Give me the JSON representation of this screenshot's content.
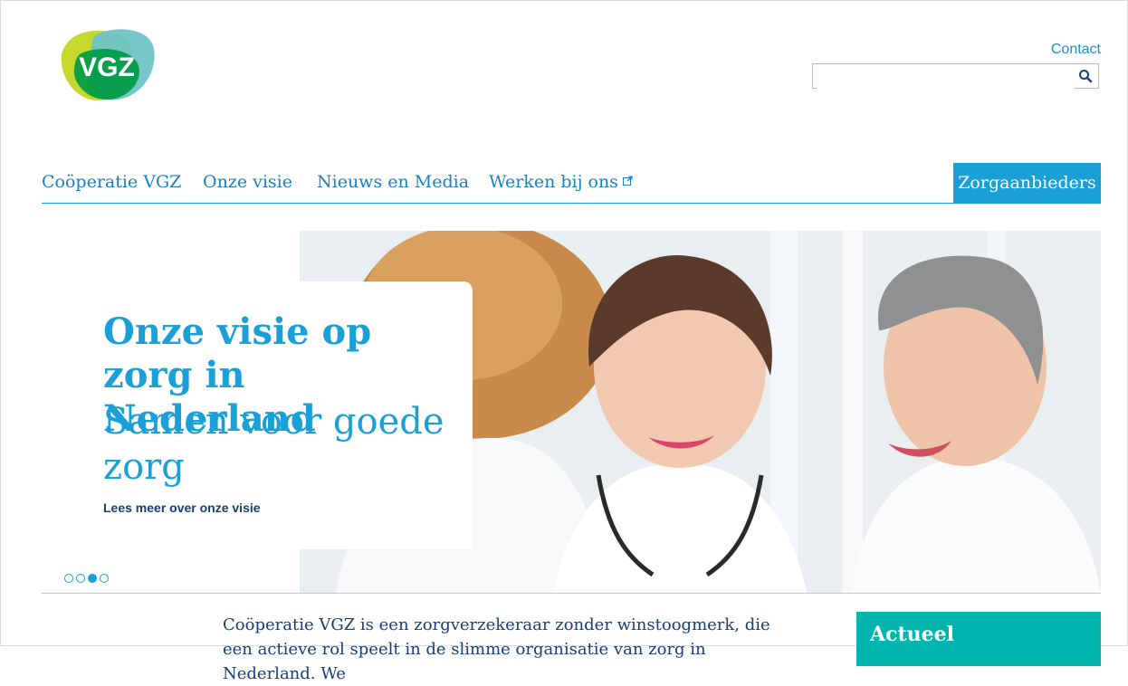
{
  "brand": {
    "logo_text": "VGZ",
    "primary": "#1a9fd6",
    "navy": "#163e7a",
    "teal": "#00b5ad"
  },
  "header": {
    "contact_label": "Contact",
    "search": {
      "placeholder": "",
      "value": ""
    },
    "search_icon": "search-icon"
  },
  "nav": {
    "items": [
      {
        "label": "Coöperatie VGZ"
      },
      {
        "label": "Onze visie"
      },
      {
        "label": "Nieuws en Media"
      },
      {
        "label": "Werken bij ons",
        "icon": "external-link-icon"
      }
    ],
    "cta_label": "Zorgaanbieders"
  },
  "hero": {
    "title": "Onze visie op zorg in Nederland",
    "subtitle": "Samen voor goede zorg",
    "link_label": "Lees meer over onze visie",
    "slides_total": 4,
    "active_slide": 3
  },
  "intro": {
    "text": "Coöperatie VGZ is een zorgverzekeraar zonder winstoogmerk, die een actieve rol speelt in de slimme organisatie van zorg in Nederland. We"
  },
  "sidebar": {
    "actueel_title": "Actueel"
  }
}
